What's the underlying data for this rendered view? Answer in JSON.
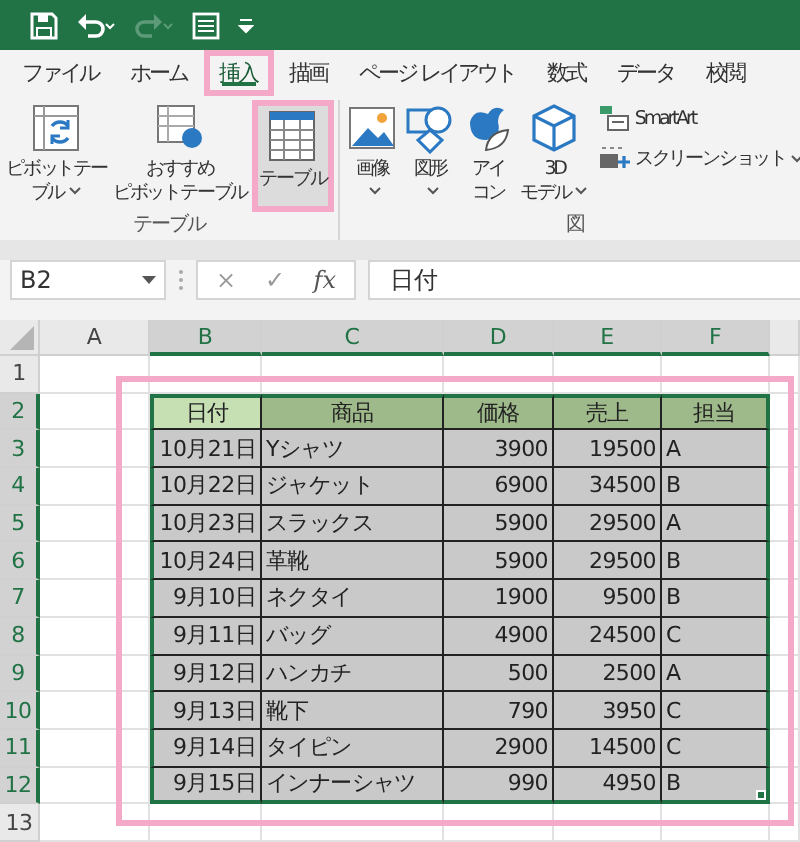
{
  "quick_access": {
    "undo_enabled": true,
    "redo_enabled": false
  },
  "tabs": [
    {
      "label": "ファイル",
      "selected": false,
      "highlighted": false
    },
    {
      "label": "ホーム",
      "selected": false,
      "highlighted": false
    },
    {
      "label": "挿入",
      "selected": true,
      "highlighted": true
    },
    {
      "label": "描画",
      "selected": false,
      "highlighted": false
    },
    {
      "label": "ページ レイアウト",
      "selected": false,
      "highlighted": false
    },
    {
      "label": "数式",
      "selected": false,
      "highlighted": false
    },
    {
      "label": "データ",
      "selected": false,
      "highlighted": false
    },
    {
      "label": "校閲",
      "selected": false,
      "highlighted": false
    }
  ],
  "ribbon_groups": [
    {
      "label": "テーブル",
      "items": [
        {
          "kind": "large",
          "lines": [
            "ピボットテー",
            "ブル"
          ],
          "dropdown": true,
          "highlighted": false
        },
        {
          "kind": "large",
          "lines": [
            "おすすめ",
            "ピボットテーブル"
          ],
          "dropdown": false,
          "highlighted": false
        },
        {
          "kind": "large",
          "lines": [
            "テーブル"
          ],
          "dropdown": false,
          "highlighted": true
        }
      ]
    },
    {
      "label": "図",
      "items": [
        {
          "kind": "large",
          "lines": [
            "画像"
          ],
          "dropdown": true,
          "highlighted": false
        },
        {
          "kind": "large",
          "lines": [
            "図形"
          ],
          "dropdown": true,
          "highlighted": false
        },
        {
          "kind": "large",
          "lines": [
            "アイ",
            "コン"
          ],
          "dropdown": false,
          "highlighted": false
        },
        {
          "kind": "large",
          "lines": [
            "3D",
            "モデル"
          ],
          "dropdown": true,
          "highlighted": false
        },
        {
          "kind": "small",
          "lines": [
            "SmartArt"
          ],
          "dropdown": false,
          "highlighted": false
        },
        {
          "kind": "small",
          "lines": [
            "スクリーンショット"
          ],
          "dropdown": true,
          "highlighted": false
        }
      ]
    }
  ],
  "formula_bar": {
    "name_box": "B2",
    "buttons": [
      "×",
      "✓",
      "fx"
    ],
    "value": "日付"
  },
  "sheet": {
    "column_headers": [
      {
        "label": "A",
        "selected": false
      },
      {
        "label": "B",
        "selected": true
      },
      {
        "label": "C",
        "selected": true
      },
      {
        "label": "D",
        "selected": true
      },
      {
        "label": "E",
        "selected": true
      },
      {
        "label": "F",
        "selected": true
      }
    ],
    "row_headers": [
      {
        "label": "1",
        "selected": false
      },
      {
        "label": "2",
        "selected": true
      },
      {
        "label": "3",
        "selected": true
      },
      {
        "label": "4",
        "selected": true
      },
      {
        "label": "5",
        "selected": true
      },
      {
        "label": "6",
        "selected": true
      },
      {
        "label": "7",
        "selected": true
      },
      {
        "label": "8",
        "selected": true
      },
      {
        "label": "9",
        "selected": true
      },
      {
        "label": "10",
        "selected": true
      },
      {
        "label": "11",
        "selected": true
      },
      {
        "label": "12",
        "selected": true
      },
      {
        "label": "13",
        "selected": false
      }
    ],
    "table": {
      "highlighted": true,
      "columns": [
        {
          "text": "日付",
          "selected": true
        },
        {
          "text": "商品",
          "selected": false
        },
        {
          "text": "価格",
          "selected": false
        },
        {
          "text": "売上",
          "selected": false
        },
        {
          "text": "担当",
          "selected": false
        }
      ],
      "rows": [
        [
          "10月21日",
          "Yシャツ",
          "3900",
          "19500",
          "A"
        ],
        [
          "10月22日",
          "ジャケット",
          "6900",
          "34500",
          "B"
        ],
        [
          "10月23日",
          "スラックス",
          "5900",
          "29500",
          "A"
        ],
        [
          "10月24日",
          "革靴",
          "5900",
          "29500",
          "B"
        ],
        [
          "9月10日",
          "ネクタイ",
          "1900",
          "9500",
          "B"
        ],
        [
          "9月11日",
          "バッグ",
          "4900",
          "24500",
          "C"
        ],
        [
          "9月12日",
          "ハンカチ",
          "500",
          "2500",
          "A"
        ],
        [
          "9月13日",
          "靴下",
          "790",
          "3950",
          "C"
        ],
        [
          "9月14日",
          "タイピン",
          "2900",
          "14500",
          "C"
        ],
        [
          "9月15日",
          "インナーシャツ",
          "990",
          "4950",
          "B"
        ]
      ]
    }
  }
}
